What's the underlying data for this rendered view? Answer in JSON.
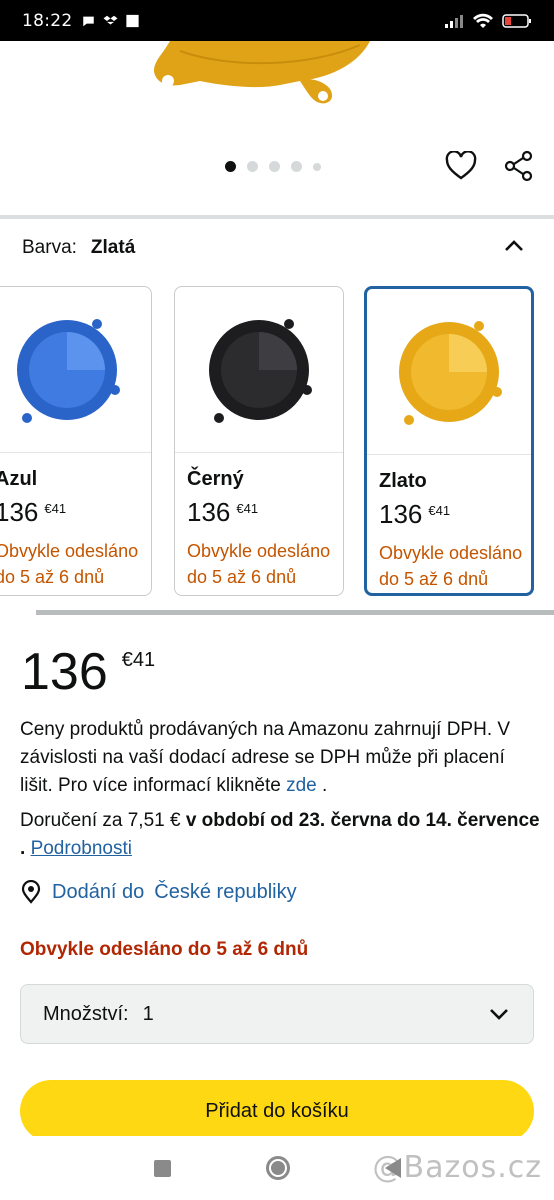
{
  "status_bar": {
    "time": "18:22",
    "battery_color": "#e8453c"
  },
  "gallery": {
    "dot_count": 5,
    "active_dot": 0
  },
  "color_selector": {
    "label": "Barva:",
    "value": "Zlatá",
    "options": [
      {
        "name": "Azul",
        "price_whole": "136",
        "price_cents": "€41",
        "shipping": "Obvykle odesláno do 5 až 6 dnů",
        "color": "#2a64c8"
      },
      {
        "name": "Černý",
        "price_whole": "136",
        "price_cents": "€41",
        "shipping": "Obvykle odesláno do 5 až 6 dnů",
        "color": "#1d1d1f"
      },
      {
        "name": "Zlato",
        "price_whole": "136",
        "price_cents": "€41",
        "shipping": "Obvykle odesláno do 5 až 6 dnů",
        "color": "#e6a817",
        "selected": true
      }
    ]
  },
  "price": {
    "whole": "136",
    "cents": "€41"
  },
  "tax_note": {
    "text": "Ceny produktů prodávaných na Amazonu zahrnují DPH. V závislosti na vaší dodací adrese se DPH může při placení lišit. Pro více informací klikněte",
    "link": "zde",
    "end": "."
  },
  "delivery": {
    "prefix": "Doručení za 7,51 €",
    "bold": "v období od 23. června do 14. července",
    "separator": ".",
    "link": "Podrobnosti"
  },
  "deliver_to": {
    "text": "Dodání do",
    "country": "České republiky"
  },
  "stock_message": "Obvykle odesláno do 5 až 6 dnů",
  "quantity": {
    "label": "Množství:",
    "value": "1"
  },
  "add_to_cart": "Přidat do košíku",
  "watermark": "@Bazos.cz"
}
